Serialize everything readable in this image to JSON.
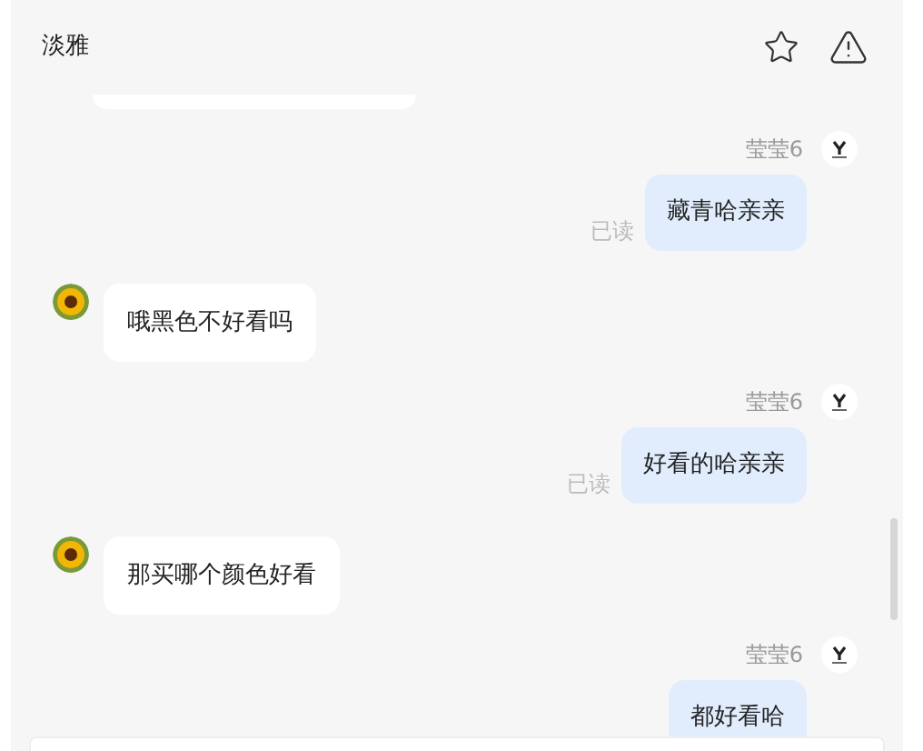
{
  "header": {
    "title": "淡雅"
  },
  "messages": [
    {
      "kind": "outgoing",
      "sender": "莹莹6",
      "text": "藏青哈亲亲",
      "read_label": "已读"
    },
    {
      "kind": "incoming",
      "text": "哦黑色不好看吗"
    },
    {
      "kind": "outgoing",
      "sender": "莹莹6",
      "text": "好看的哈亲亲",
      "read_label": "已读"
    },
    {
      "kind": "incoming",
      "text": "那买哪个颜色好看"
    },
    {
      "kind": "outgoing",
      "sender": "莹莹6",
      "text": "都好看哈"
    }
  ]
}
